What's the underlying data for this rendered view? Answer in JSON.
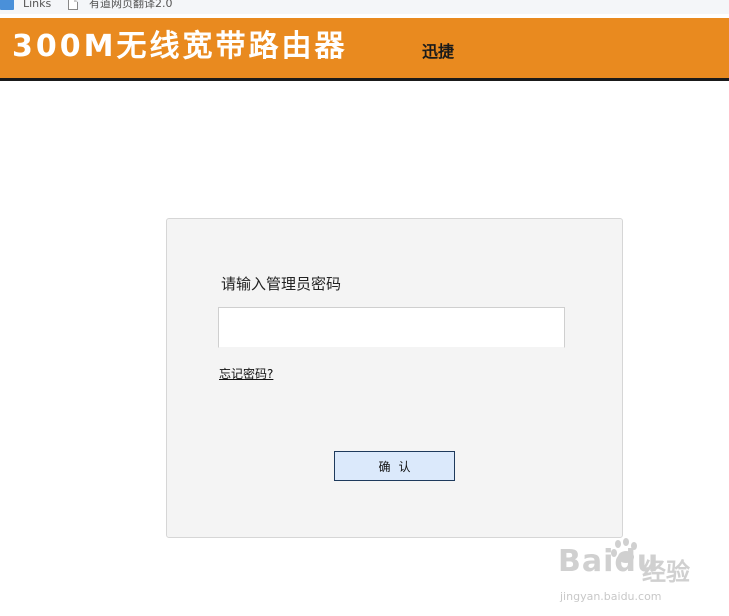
{
  "bookmarks": [
    {
      "label": "Links",
      "icon": "folder-icon"
    },
    {
      "label": "有道网页翻译2.0",
      "icon": "page-icon"
    }
  ],
  "header": {
    "title": "300M无线宽带路由器",
    "brand": "迅捷",
    "background_color": "#e98a1f",
    "title_color": "#ffffff"
  },
  "login": {
    "prompt": "请输入管理员密码",
    "password_value": "",
    "forgot_link": "忘记密码?",
    "confirm_label": "确认"
  },
  "watermark": {
    "logo_text": "Baidu",
    "logo_suffix": "经验",
    "url": "jingyan.baidu.com"
  }
}
